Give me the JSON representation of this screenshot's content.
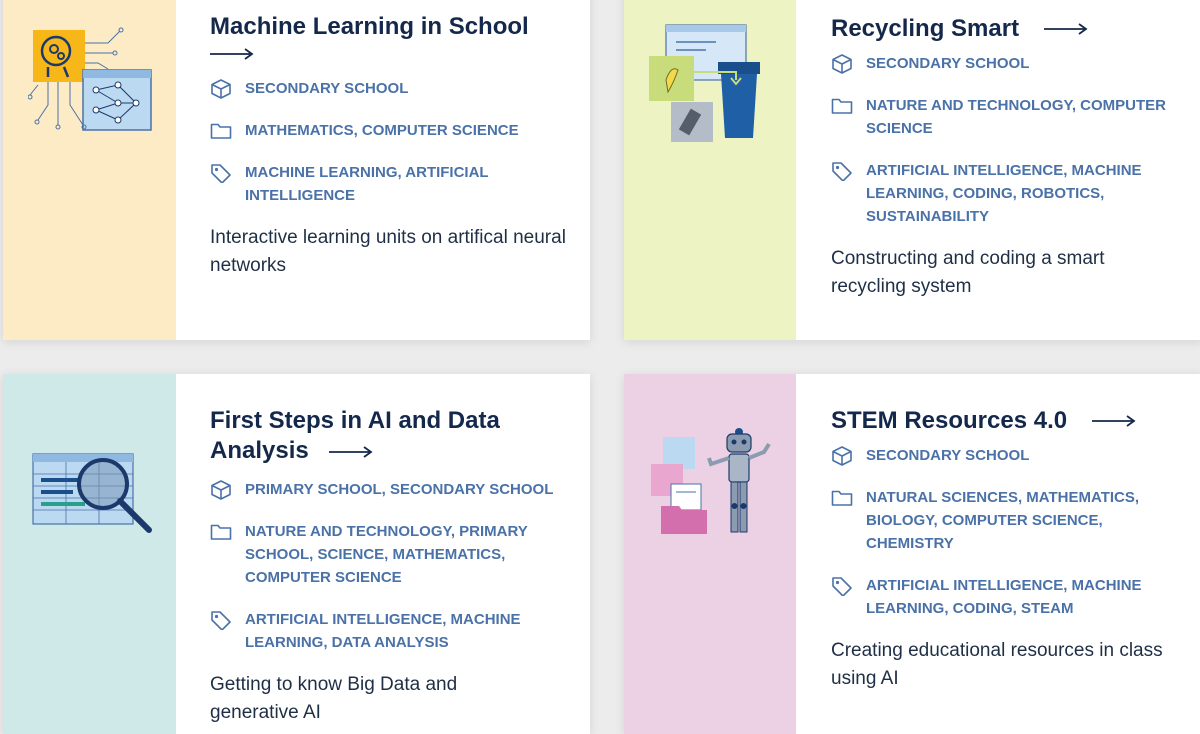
{
  "cards": [
    {
      "title": "Machine Learning in School",
      "level": "SECONDARY SCHOOL",
      "subjects": "MATHEMATICS, COMPUTER SCIENCE",
      "tags": "MACHINE LEARNING, ARTIFICIAL INTELLIGENCE",
      "description": "Interactive learning units on artifical neural networks",
      "panel_color": "#fcebc4"
    },
    {
      "title": "Recycling Smart",
      "level": "SECONDARY SCHOOL",
      "subjects": "NATURE AND TECHNOLOGY, COMPUTER SCIENCE",
      "tags": "ARTIFICIAL INTELLIGENCE, MACHINE LEARNING, CODING, ROBOTICS, SUSTAINABILITY",
      "description": "Constructing and coding a smart recycling system",
      "panel_color": "#eef3c4"
    },
    {
      "title": "First Steps in AI and Data Analysis",
      "level": "PRIMARY SCHOOL, SECONDARY SCHOOL",
      "subjects": "NATURE AND TECHNOLOGY, PRIMARY SCHOOL, SCIENCE, MATHEMATICS, COMPUTER SCIENCE",
      "tags": "ARTIFICIAL INTELLIGENCE, MACHINE LEARNING, DATA ANALYSIS",
      "description": "Getting to know Big Data and generative AI",
      "panel_color": "#cfe9e8"
    },
    {
      "title": "STEM Resources 4.0",
      "level": "SECONDARY SCHOOL",
      "subjects": "NATURAL SCIENCES, MATHEMATICS, BIOLOGY, COMPUTER SCIENCE, CHEMISTRY",
      "tags": "ARTIFICIAL INTELLIGENCE, MACHINE LEARNING, CODING, STEAM",
      "description": "Creating educational resources in class using AI",
      "panel_color": "#ebd1e3"
    }
  ],
  "icons": {
    "level": "cube-icon",
    "subjects": "folder-icon",
    "tags": "tag-icon",
    "link": "arrow-right-icon"
  },
  "colors": {
    "title": "#14284b",
    "meta": "#4a72a8",
    "description": "#1f2f45"
  }
}
